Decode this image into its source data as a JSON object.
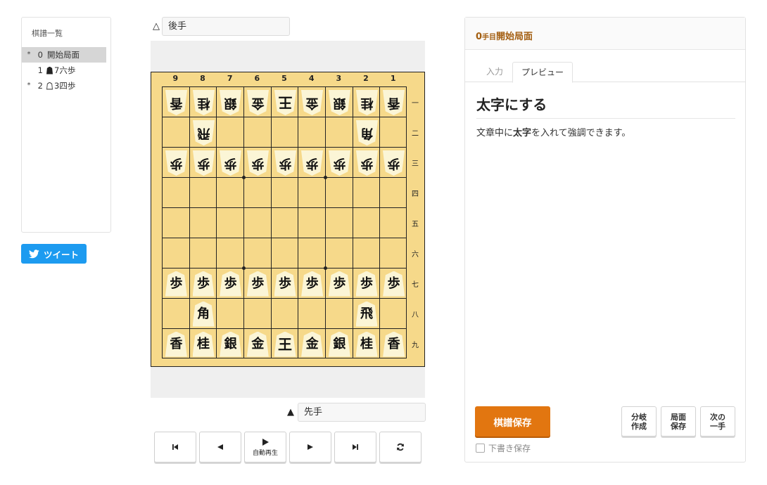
{
  "kifu": {
    "title": "棋譜一覧",
    "moves": [
      {
        "mark": "*",
        "num": "0",
        "text": "開始局面",
        "selected": true,
        "side": ""
      },
      {
        "mark": "",
        "num": "1",
        "text": "7六歩",
        "selected": false,
        "side": "black"
      },
      {
        "mark": "*",
        "num": "2",
        "text": "3四歩",
        "selected": false,
        "side": "white"
      }
    ]
  },
  "tweet": {
    "label": "ツイート"
  },
  "gote": {
    "mark": "△",
    "name": "後手"
  },
  "sente": {
    "mark": "▲",
    "name": "先手"
  },
  "board": {
    "files": [
      "9",
      "8",
      "7",
      "6",
      "5",
      "4",
      "3",
      "2",
      "1"
    ],
    "ranks": [
      "一",
      "二",
      "三",
      "四",
      "五",
      "六",
      "七",
      "八",
      "九"
    ],
    "pieces": [
      {
        "file": 9,
        "rank": 1,
        "kanji": "香",
        "owner": "gote"
      },
      {
        "file": 8,
        "rank": 1,
        "kanji": "桂",
        "owner": "gote"
      },
      {
        "file": 7,
        "rank": 1,
        "kanji": "銀",
        "owner": "gote"
      },
      {
        "file": 6,
        "rank": 1,
        "kanji": "金",
        "owner": "gote"
      },
      {
        "file": 5,
        "rank": 1,
        "kanji": "王",
        "owner": "gote",
        "king": true
      },
      {
        "file": 4,
        "rank": 1,
        "kanji": "金",
        "owner": "gote"
      },
      {
        "file": 3,
        "rank": 1,
        "kanji": "銀",
        "owner": "gote"
      },
      {
        "file": 2,
        "rank": 1,
        "kanji": "桂",
        "owner": "gote"
      },
      {
        "file": 1,
        "rank": 1,
        "kanji": "香",
        "owner": "gote"
      },
      {
        "file": 8,
        "rank": 2,
        "kanji": "飛",
        "owner": "gote"
      },
      {
        "file": 2,
        "rank": 2,
        "kanji": "角",
        "owner": "gote"
      },
      {
        "file": 9,
        "rank": 3,
        "kanji": "歩",
        "owner": "gote"
      },
      {
        "file": 8,
        "rank": 3,
        "kanji": "歩",
        "owner": "gote"
      },
      {
        "file": 7,
        "rank": 3,
        "kanji": "歩",
        "owner": "gote"
      },
      {
        "file": 6,
        "rank": 3,
        "kanji": "歩",
        "owner": "gote"
      },
      {
        "file": 5,
        "rank": 3,
        "kanji": "歩",
        "owner": "gote"
      },
      {
        "file": 4,
        "rank": 3,
        "kanji": "歩",
        "owner": "gote"
      },
      {
        "file": 3,
        "rank": 3,
        "kanji": "歩",
        "owner": "gote"
      },
      {
        "file": 2,
        "rank": 3,
        "kanji": "歩",
        "owner": "gote"
      },
      {
        "file": 1,
        "rank": 3,
        "kanji": "歩",
        "owner": "gote"
      },
      {
        "file": 9,
        "rank": 7,
        "kanji": "歩",
        "owner": "sente"
      },
      {
        "file": 8,
        "rank": 7,
        "kanji": "歩",
        "owner": "sente"
      },
      {
        "file": 7,
        "rank": 7,
        "kanji": "歩",
        "owner": "sente"
      },
      {
        "file": 6,
        "rank": 7,
        "kanji": "歩",
        "owner": "sente"
      },
      {
        "file": 5,
        "rank": 7,
        "kanji": "歩",
        "owner": "sente"
      },
      {
        "file": 4,
        "rank": 7,
        "kanji": "歩",
        "owner": "sente"
      },
      {
        "file": 3,
        "rank": 7,
        "kanji": "歩",
        "owner": "sente"
      },
      {
        "file": 2,
        "rank": 7,
        "kanji": "歩",
        "owner": "sente"
      },
      {
        "file": 1,
        "rank": 7,
        "kanji": "歩",
        "owner": "sente"
      },
      {
        "file": 8,
        "rank": 8,
        "kanji": "角",
        "owner": "sente"
      },
      {
        "file": 2,
        "rank": 8,
        "kanji": "飛",
        "owner": "sente"
      },
      {
        "file": 9,
        "rank": 9,
        "kanji": "香",
        "owner": "sente"
      },
      {
        "file": 8,
        "rank": 9,
        "kanji": "桂",
        "owner": "sente"
      },
      {
        "file": 7,
        "rank": 9,
        "kanji": "銀",
        "owner": "sente"
      },
      {
        "file": 6,
        "rank": 9,
        "kanji": "金",
        "owner": "sente"
      },
      {
        "file": 5,
        "rank": 9,
        "kanji": "王",
        "owner": "sente",
        "king": true
      },
      {
        "file": 4,
        "rank": 9,
        "kanji": "金",
        "owner": "sente"
      },
      {
        "file": 3,
        "rank": 9,
        "kanji": "銀",
        "owner": "sente"
      },
      {
        "file": 2,
        "rank": 9,
        "kanji": "桂",
        "owner": "sente"
      },
      {
        "file": 1,
        "rank": 9,
        "kanji": "香",
        "owner": "sente"
      }
    ]
  },
  "controls": {
    "autoplay_label": "自動再生",
    "buttons": [
      "first-move",
      "prev-move",
      "autoplay",
      "next-move",
      "last-move",
      "flip-board"
    ]
  },
  "editor": {
    "move_number": "0",
    "move_unit": "手目",
    "move_title": "開始局面",
    "tabs": {
      "input": "入力",
      "preview": "プレビュー",
      "active": "preview"
    },
    "preview_heading": "太字にする",
    "preview_text_before": "文章中に",
    "preview_text_bold": "太字",
    "preview_text_after": "を入れて強調できます。",
    "save_kifu_label": "棋譜保存",
    "branch_label": "分岐\n作成",
    "save_position_label": "局面\n保存",
    "next_move_label": "次の\n一手",
    "draft_label": "下書き保存",
    "draft_checked": false
  },
  "colors": {
    "board": "#f6d98a",
    "accent": "#e27610",
    "heading": "#a35e10",
    "twitter": "#1d9bf0",
    "promoted": "#b01010"
  }
}
